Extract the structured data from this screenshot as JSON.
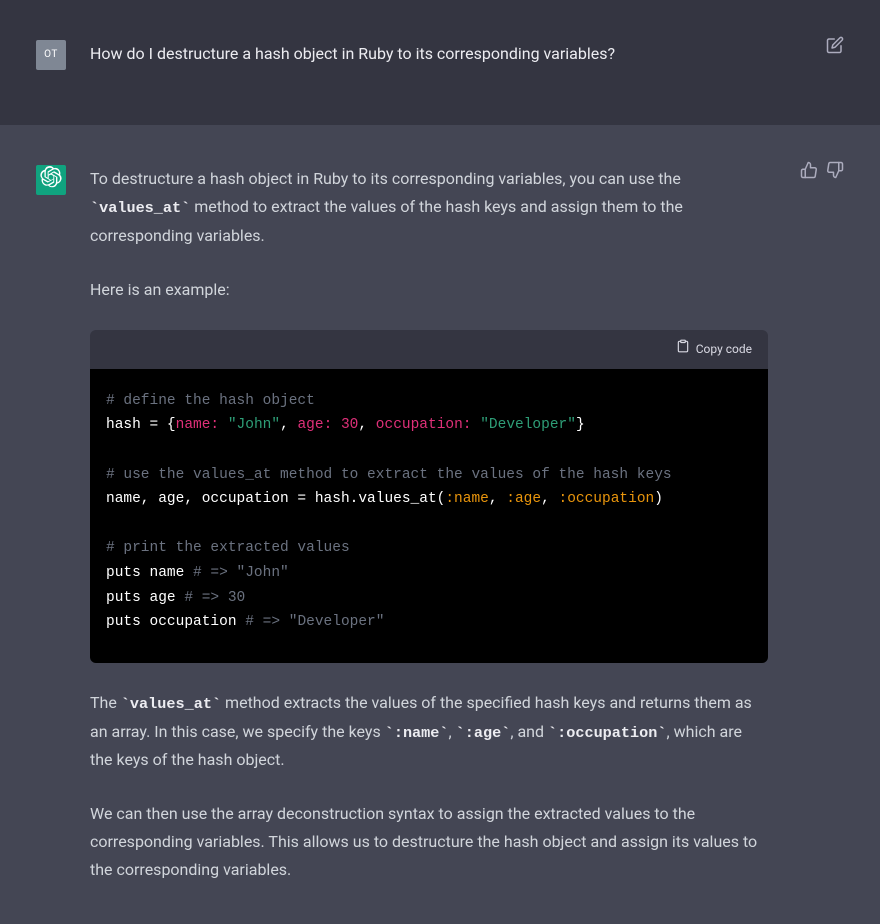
{
  "user": {
    "avatar_initials": "OT",
    "question": "How do I destructure a hash object in Ruby to its corresponding variables?"
  },
  "controls": {
    "edit_label": "Edit",
    "like_label": "Like",
    "dislike_label": "Dislike",
    "copy_code_label": "Copy code"
  },
  "assistant": {
    "p1_pre": "To destructure a hash object in Ruby to its corresponding variables, you can use the ",
    "p1_code": "`values_at`",
    "p1_post": " method to extract the values of the hash keys and assign them to the corresponding variables.",
    "p2": "Here is an example:",
    "p3_pre": "The ",
    "p3_c1": "`values_at`",
    "p3_mid1": " method extracts the values of the specified hash keys and returns them as an array. In this case, we specify the keys ",
    "p3_c2": "`:name`",
    "p3_sep1": ", ",
    "p3_c3": "`:age`",
    "p3_mid2": ", and ",
    "p3_c4": "`:occupation`",
    "p3_post": ", which are the keys of the hash object.",
    "p4": "We can then use the array deconstruction syntax to assign the extracted values to the corresponding variables. This allows us to destructure the hash object and assign its values to the corresponding variables."
  },
  "code": {
    "c1": "# define the hash object",
    "l2_a": "hash = {",
    "l2_k1": "name:",
    "l2_s1": "\"John\"",
    "l2_k2": "age:",
    "l2_n1": "30",
    "l2_k3": "occupation:",
    "l2_s2": "\"Developer\"",
    "l2_b": "}",
    "c2": "# use the values_at method to extract the values of the hash keys",
    "l4_a": "name, age, occupation = hash.values_at(",
    "l4_s1": ":name",
    "l4_s2": ":age",
    "l4_s3": ":occupation",
    "l4_b": ")",
    "c3": "# print the extracted values",
    "l6_a": "puts name ",
    "l6_c": "# => \"John\"",
    "l7_a": "puts age ",
    "l7_c": "# => 30",
    "l8_a": "puts occupation ",
    "l8_c": "# => \"Developer\""
  }
}
